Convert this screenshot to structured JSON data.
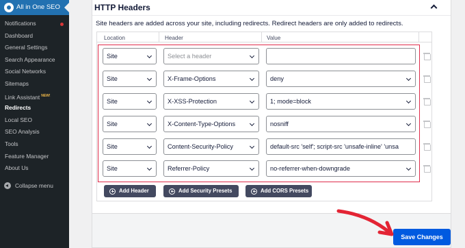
{
  "sidebar": {
    "brand": "All in One SEO",
    "items": [
      {
        "label": "Notifications",
        "dot": true
      },
      {
        "label": "Dashboard"
      },
      {
        "label": "General Settings"
      },
      {
        "label": "Search Appearance"
      },
      {
        "label": "Social Networks"
      },
      {
        "label": "Sitemaps"
      },
      {
        "label": "Link Assistant",
        "badge": "NEW!"
      },
      {
        "label": "Redirects",
        "active": true
      },
      {
        "label": "Local SEO"
      },
      {
        "label": "SEO Analysis"
      },
      {
        "label": "Tools"
      },
      {
        "label": "Feature Manager"
      },
      {
        "label": "About Us"
      }
    ],
    "collapse_label": "Collapse menu"
  },
  "card": {
    "title": "HTTP Headers",
    "description": "Site headers are added across your site, including redirects. Redirect headers are only added to redirects."
  },
  "table": {
    "columns": [
      "Location",
      "Header",
      "Value"
    ],
    "rows": [
      {
        "location": "Site",
        "header": "Select a header",
        "header_placeholder": true,
        "value": "",
        "value_dropdown": false
      },
      {
        "location": "Site",
        "header": "X-Frame-Options",
        "value": "deny",
        "value_dropdown": true
      },
      {
        "location": "Site",
        "header": "X-XSS-Protection",
        "value": "1; mode=block",
        "value_dropdown": true
      },
      {
        "location": "Site",
        "header": "X-Content-Type-Options",
        "value": "nosniff",
        "value_dropdown": true
      },
      {
        "location": "Site",
        "header": "Content-Security-Policy",
        "value": "default-src 'self'; script-src 'unsafe-inline' 'unsa",
        "value_dropdown": false
      },
      {
        "location": "Site",
        "header": "Referrer-Policy",
        "value": "no-referrer-when-downgrade",
        "value_dropdown": true
      }
    ]
  },
  "buttons": {
    "add_header": "Add Header",
    "add_security": "Add Security Presets",
    "add_cors": "Add CORS Presets",
    "save": "Save Changes"
  },
  "colors": {
    "sidebar_bg": "#1d2327",
    "brand_bg": "#2271b1",
    "highlight_red": "#df2a4a",
    "save_blue": "#005ae0",
    "preset_btn": "#434960"
  }
}
